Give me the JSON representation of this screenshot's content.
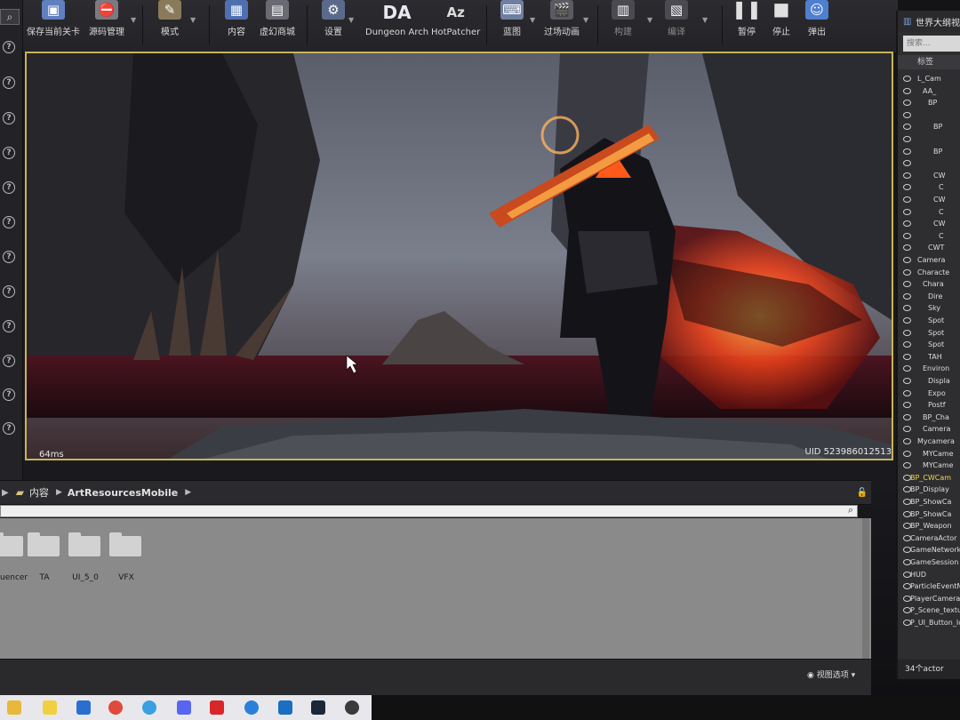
{
  "toolbar": {
    "buttons": [
      {
        "label": "保存当前关卡",
        "icon": "save-icon"
      },
      {
        "label": "源码管理",
        "icon": "source-control-icon"
      },
      {
        "label": "模式",
        "icon": "modes-icon"
      },
      {
        "label": "内容",
        "icon": "content-icon"
      },
      {
        "label": "虚幻商城",
        "icon": "marketplace-icon"
      },
      {
        "label": "设置",
        "icon": "settings-icon"
      },
      {
        "label": "Dungeon Arch",
        "icon": "dungeon-arch-icon",
        "icon_text": "DA"
      },
      {
        "label": "HotPatcher",
        "icon": "hotpatcher-icon"
      },
      {
        "label": "蓝图",
        "icon": "blueprint-icon"
      },
      {
        "label": "过场动画",
        "icon": "cinematics-icon"
      },
      {
        "label": "构建",
        "icon": "build-icon"
      },
      {
        "label": "编译",
        "icon": "compile-icon"
      },
      {
        "label": "暂停",
        "icon": "pause-icon"
      },
      {
        "label": "停止",
        "icon": "stop-icon"
      },
      {
        "label": "弹出",
        "icon": "eject-icon"
      }
    ]
  },
  "viewport": {
    "frame_time": "64ms",
    "uid": "UID 523986012513"
  },
  "content_browser": {
    "breadcrumb": [
      "内容",
      "ArtResourcesMobile"
    ],
    "folders": [
      "uencer",
      "TA",
      "UI_5_0",
      "VFX"
    ],
    "view_options": "视图选项"
  },
  "outliner": {
    "title": "世界大纲视图",
    "search_placeholder": "搜索...",
    "column_label": "标签",
    "items": [
      "L_Cam",
      "AA_",
      "BP",
      "",
      "BP",
      "",
      "BP",
      "",
      "CW",
      "C",
      "CW",
      "C",
      "CW",
      "C",
      "CWT",
      "Camera",
      "Characte",
      "Chara",
      "Dire",
      "Sky",
      "Spot",
      "Spot",
      "Spot",
      "TAH",
      "Environ",
      "Displa",
      "Expo",
      "Postf",
      "BP_Cha",
      "Camera",
      "Mycamera",
      "MYCame",
      "MYCame",
      "BP_CWCam",
      "BP_Display",
      "BP_ShowCa",
      "BP_ShowCa",
      "BP_Weapon",
      "CameraActor",
      "GameNetwork",
      "GameSession",
      "HUD",
      "ParticleEventM",
      "PlayerCameraM",
      "P_Scene_textur",
      "P_UI_Button_Ic"
    ],
    "actor_count": "34个actor"
  },
  "colors": {
    "viewport_border": "#c9b458",
    "accent_orange": "#ff6a1a",
    "highlight_yellow": "#f5d742"
  }
}
